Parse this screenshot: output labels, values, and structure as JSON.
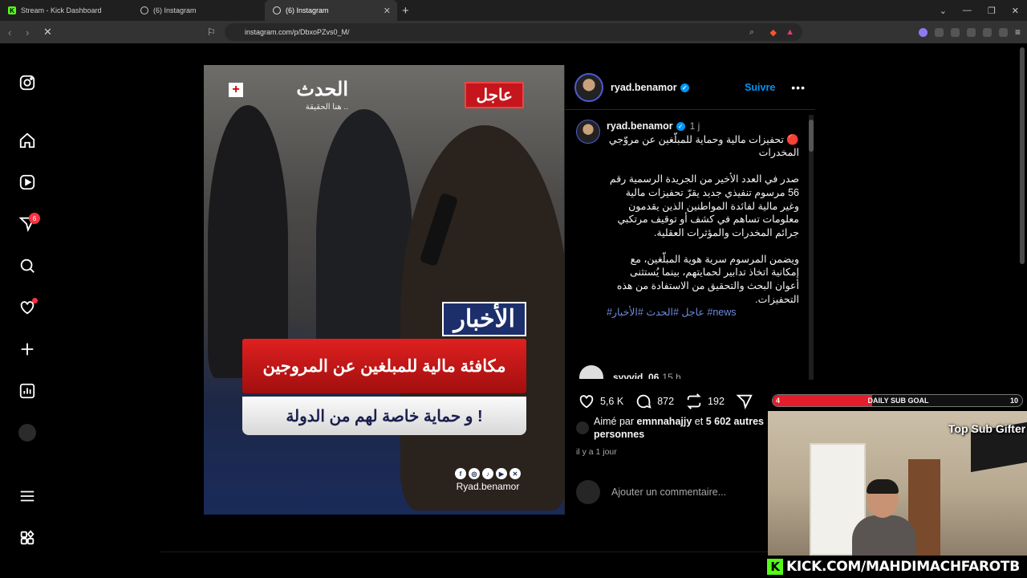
{
  "browser": {
    "tabs": [
      {
        "title": "Stream - Kick Dashboard",
        "icon": "kick-icon"
      },
      {
        "title": "(6) Instagram",
        "icon": "instagram-icon"
      },
      {
        "title": "(6) Instagram",
        "icon": "instagram-icon"
      }
    ],
    "url": "instagram.com/p/DbxoPZvs0_M/"
  },
  "sidebar": {
    "messages_badge": "6"
  },
  "post": {
    "image": {
      "brand_name": "الحدث",
      "brand_tagline": "هنا الحقيقة ..",
      "urgent_label": "عاجل",
      "section_label": "الأخبار",
      "headline": "مكافئة مالية للمبلغين عن المروجين",
      "subheadline": "و حماية خاصة لهم من الدولة !",
      "handle": "Ryad.benamor"
    },
    "author": "ryad.benamor",
    "follow_label": "Suivre",
    "caption_time": "1 j",
    "caption_title": "تحفيزات مالية وحماية للمبلّغين عن مروّجي المخدرات",
    "caption_p1": "صدر في العدد الأخير من الجريدة الرسمية رقم 56 مرسوم تنفيذي جديد يقرّ تحفيزات مالية وغير مالية لفائدة المواطنين الذين يقدمون معلومات تساهم في كشف أو توقيف مرتكبي جرائم المخدرات والمؤثرات العقلية.",
    "caption_p2": "ويضمن المرسوم سرية هوية المبلّغين، مع إمكانية اتخاذ تدابير لحمايتهم، بينما يُستثنى أعوان البحث والتحقيق من الاستفادة من هذه التحفيزات.",
    "hashtags": "#عاجل #الحدث #الأخبار #news",
    "first_comment": {
      "user": "syvvid_06",
      "time": "15 h"
    },
    "likes": "5,6 K",
    "comments": "872",
    "reposts": "192",
    "liked_by_prefix": "Aimé par",
    "liked_by_user": "emnnahajjy",
    "liked_by_and": "et",
    "liked_by_rest": "5 602 autres personnes",
    "posted_ago": "il y a 1 jour",
    "add_comment_placeholder": "Ajouter un commentaire..."
  },
  "stream_overlay": {
    "goal_current": "4",
    "goal_label": "DAILY SUB GOAL",
    "goal_target": "10",
    "goal_progress": 0.4,
    "top_sub_gifter": "Top Sub Gifter",
    "kick_url": "KICK.COM/MAHDIMACHFAROTB"
  },
  "colors": {
    "accent": "#0095f6",
    "badge": "#ff3040",
    "kick_green": "#53fc18",
    "goal_red": "#e31d2b"
  }
}
